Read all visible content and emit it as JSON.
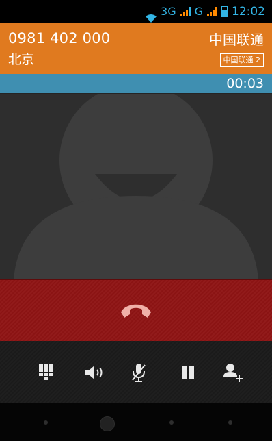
{
  "status_bar": {
    "network_label_1": "3G",
    "network_label_2": "G",
    "time": "12:02",
    "accent_color": "#33b5e5",
    "signal_color": "#ff8a00"
  },
  "caller": {
    "number": "0981 402 000",
    "location": "北京",
    "carrier": "中国联通",
    "sim_label": "中国联通 2",
    "header_color": "#e07a1f"
  },
  "call": {
    "duration": "00:03",
    "duration_bar_color": "#3f8fb1",
    "end_call_icon": "hangup-icon",
    "end_area_color": "#8f1414"
  },
  "controls": {
    "buttons": [
      {
        "name": "dialpad",
        "icon": "dialpad-icon"
      },
      {
        "name": "speaker",
        "icon": "speaker-icon"
      },
      {
        "name": "mute",
        "icon": "mic-mute-icon"
      },
      {
        "name": "hold",
        "icon": "pause-icon"
      },
      {
        "name": "add-call",
        "icon": "add-contact-icon"
      }
    ]
  },
  "navigation": {
    "buttons": [
      "back",
      "home",
      "recent",
      "menu"
    ]
  }
}
